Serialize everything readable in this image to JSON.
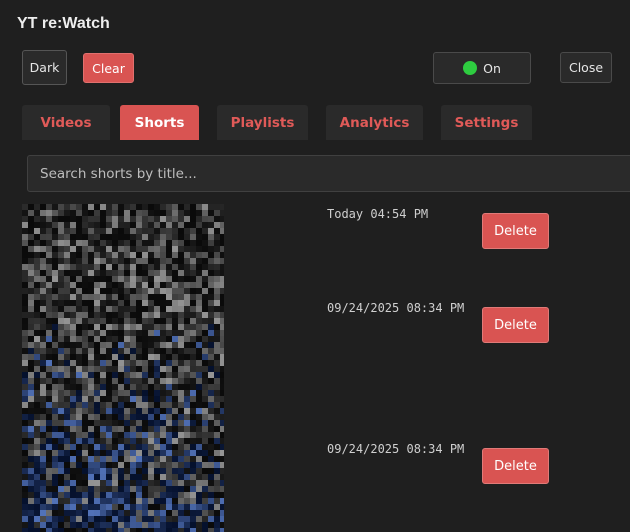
{
  "header": {
    "title": "YT re:Watch"
  },
  "toolbar": {
    "theme_label": "Dark",
    "clear_label": "Clear",
    "toggle_label": "On",
    "toggle_color": "#2ecc40",
    "close_label": "Close"
  },
  "tabs": [
    {
      "label": "Videos",
      "active": false
    },
    {
      "label": "Shorts",
      "active": true
    },
    {
      "label": "Playlists",
      "active": false
    },
    {
      "label": "Analytics",
      "active": false
    },
    {
      "label": "Settings",
      "active": false
    }
  ],
  "search": {
    "placeholder": "Search shorts by title..."
  },
  "shorts": [
    {
      "date": "Today 04:54 PM",
      "delete_label": "Delete"
    },
    {
      "date": "09/24/2025 08:34 PM",
      "delete_label": "Delete"
    },
    {
      "date": "09/24/2025 08:34 PM",
      "delete_label": "Delete"
    }
  ],
  "colors": {
    "accent": "#d95452",
    "background": "#1f1f1f",
    "surface": "#2a2a2a"
  }
}
